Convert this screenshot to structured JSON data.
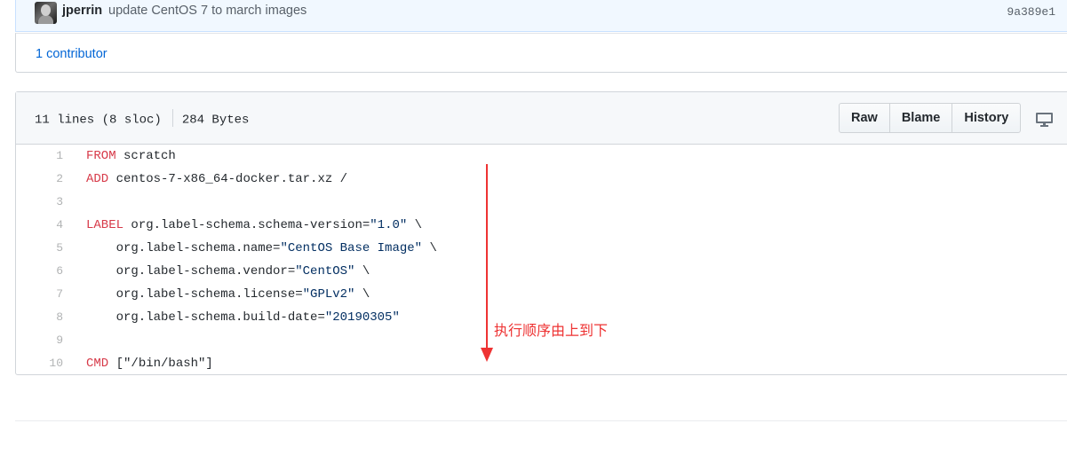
{
  "commit": {
    "author": "jperrin",
    "message": "update CentOS 7 to march images",
    "sha": "9a389e1"
  },
  "contributors": {
    "label": "1 contributor"
  },
  "file": {
    "lines_info": "11 lines (8 sloc)",
    "size": "284 Bytes",
    "buttons": {
      "raw": "Raw",
      "blame": "Blame",
      "history": "History"
    },
    "desktop_icon": "monitor-icon"
  },
  "code": {
    "lines": [
      {
        "n": "1",
        "kw": "FROM",
        "rest": " scratch"
      },
      {
        "n": "2",
        "kw": "ADD",
        "rest": " centos-7-x86_64-docker.tar.xz /"
      },
      {
        "n": "3",
        "kw": "",
        "rest": ""
      },
      {
        "n": "4",
        "kw": "LABEL",
        "rest": " org.label-schema.schema-version=",
        "str": "\"1.0\"",
        "tail": " \\"
      },
      {
        "n": "5",
        "kw": "",
        "rest": "    org.label-schema.name=",
        "str": "\"CentOS Base Image\"",
        "tail": " \\"
      },
      {
        "n": "6",
        "kw": "",
        "rest": "    org.label-schema.vendor=",
        "str": "\"CentOS\"",
        "tail": " \\"
      },
      {
        "n": "7",
        "kw": "",
        "rest": "    org.label-schema.license=",
        "str": "\"GPLv2\"",
        "tail": " \\"
      },
      {
        "n": "8",
        "kw": "",
        "rest": "    org.label-schema.build-date=",
        "str": "\"20190305\"",
        "tail": ""
      },
      {
        "n": "9",
        "kw": "",
        "rest": ""
      },
      {
        "n": "10",
        "kw": "CMD",
        "rest": " [\"/bin/bash\"]"
      }
    ]
  },
  "annotation": {
    "text": "执行顺序由上到下",
    "color": "#ee3333"
  },
  "colors": {
    "link": "#0366d6",
    "keyword": "#d73a49",
    "string": "#032f62",
    "commit_bar_bg": "#f1f8ff"
  }
}
